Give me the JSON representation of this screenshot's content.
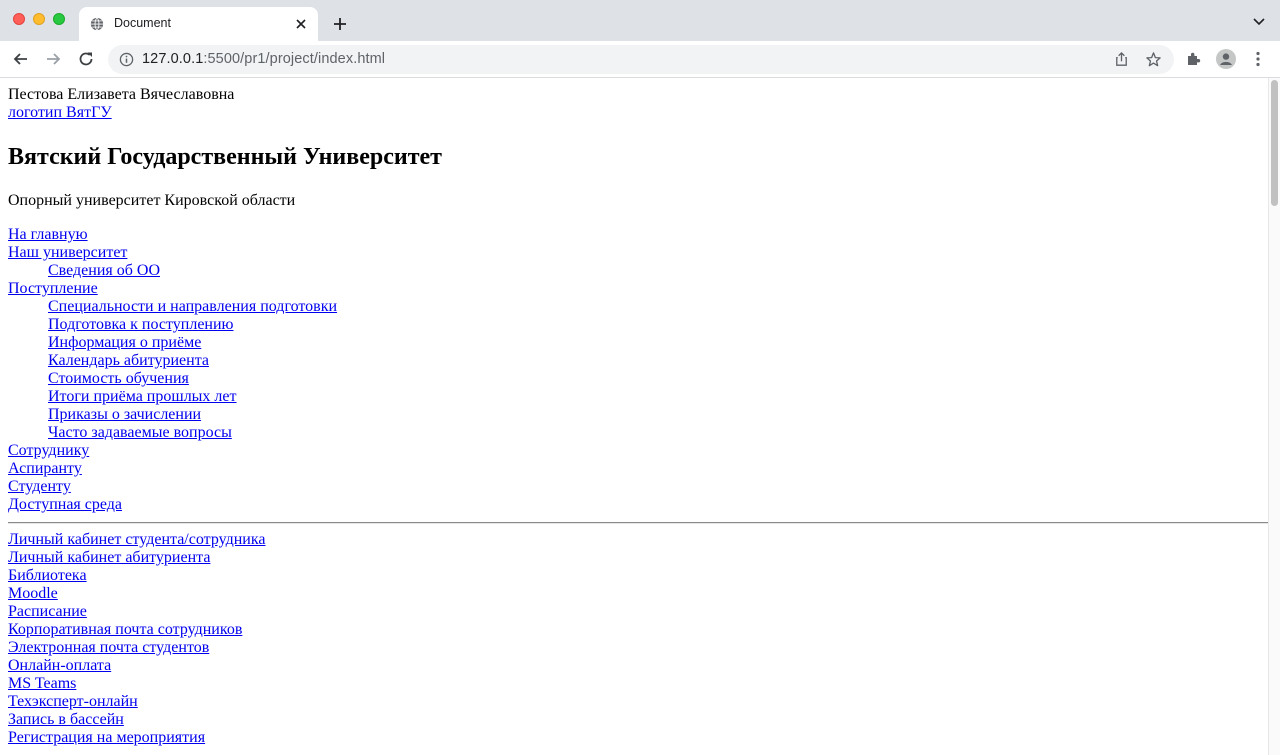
{
  "browser": {
    "tab_title": "Document",
    "url_host": "127.0.0.1",
    "url_path": ":5500/pr1/project/index.html",
    "icons": [
      "globe-icon",
      "close-icon",
      "plus-icon",
      "chevron-down-icon",
      "back-arrow-icon",
      "forward-arrow-icon",
      "reload-icon",
      "info-icon",
      "share-icon",
      "star-icon",
      "extensions-icon",
      "profile-icon",
      "more-vert-icon"
    ]
  },
  "page": {
    "author": "Пестова Елизавета Вячеславовна",
    "logo_alt": "логотип ВятГУ",
    "title": "Вятский Государственный Университет",
    "tagline": "Опорный университет Кировской области",
    "menu": {
      "home": "На главную",
      "university": "Наш университет",
      "university_sub": [
        "Сведения об ОО"
      ],
      "admission": "Поступление",
      "admission_sub": [
        "Специальности и направления подготовки",
        "Подготовка к поступлению",
        "Информация о приёме",
        "Календарь абитуриента",
        "Стоимость обучения",
        "Итоги приёма прошлых лет",
        "Приказы о зачислении",
        "Часто задаваемые вопросы"
      ],
      "after": [
        "Сотруднику",
        "Аспиранту",
        "Студенту",
        "Доступная среда"
      ]
    },
    "services": [
      "Личный кабинет студента/сотрудника",
      "Личный кабинет абитуриента",
      "Библиотека",
      "Moodle",
      "Расписание",
      "Корпоративная почта сотрудников",
      "Электронная почта студентов",
      "Онлайн-оплата",
      "MS Teams",
      "Техэксперт-онлайн",
      "Запись в бассейн",
      "Регистрация на мероприятия"
    ]
  }
}
